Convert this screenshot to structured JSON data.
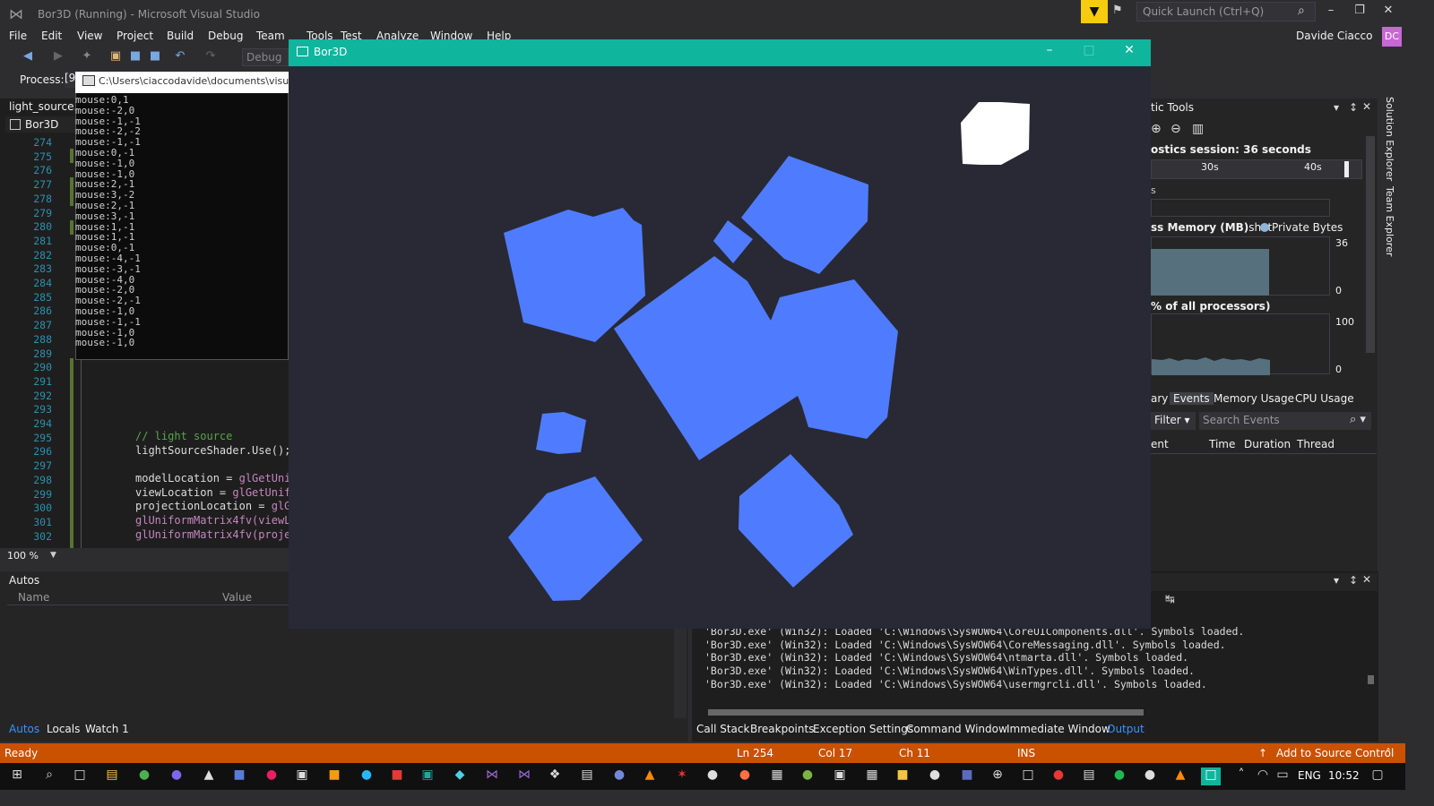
{
  "vs": {
    "title": "Bor3D (Running) - Microsoft Visual Studio",
    "quick_launch_placeholder": "Quick Launch (Ctrl+Q)",
    "user_name": "Davide Ciacco",
    "user_initials": "DC",
    "menus": [
      "File",
      "Edit",
      "View",
      "Project",
      "Build",
      "Debug",
      "Team",
      "Tools",
      "Test",
      "Analyze",
      "Window",
      "Help"
    ],
    "debug_config": "Debug",
    "process_label": "Process:",
    "process_value": "[9"
  },
  "console": {
    "path": "C:\\Users\\ciaccodavide\\documents\\visua",
    "lines": [
      "mouse:0,1",
      "mouse:-2,0",
      "mouse:-1,-1",
      "mouse:-2,-2",
      "mouse:-1,-1",
      "mouse:0,-1",
      "mouse:-1,0",
      "mouse:-1,0",
      "mouse:2,-1",
      "mouse:3,-2",
      "mouse:2,-1",
      "mouse:3,-1",
      "mouse:1,-1",
      "mouse:1,-1",
      "mouse:0,-1",
      "mouse:-4,-1",
      "mouse:-3,-1",
      "mouse:-4,0",
      "mouse:-2,0",
      "mouse:-2,-1",
      "mouse:-1,0",
      "mouse:-1,-1",
      "mouse:-1,0",
      "mouse:-1,0"
    ]
  },
  "editor": {
    "file_tab": "light_source.fr",
    "project_tab": "Bor3D",
    "line_numbers": [
      "274",
      "275",
      "276",
      "277",
      "278",
      "279",
      "280",
      "281",
      "282",
      "283",
      "284",
      "285",
      "286",
      "287",
      "288",
      "289",
      "290",
      "291",
      "292",
      "293",
      "294",
      "295",
      "296",
      "297",
      "298",
      "299",
      "300",
      "301",
      "302"
    ],
    "code": {
      "comment": "// light source",
      "use": "lightSourceShader.Use();",
      "l298_a": "modelLocation = ",
      "l298_b": "glGetUnif",
      "l299_a": "viewLocation = ",
      "l299_b": "glGetUnifo",
      "l300_a": "projectionLocation = ",
      "l300_b": "glGe",
      "l301": "glUniformMatrix4fv(viewLo",
      "l302": "glUniformMatrix4fv(projec"
    },
    "zoom": "100 %"
  },
  "autos": {
    "title": "Autos",
    "col_name": "Name",
    "col_value": "Value",
    "tabs": [
      "Autos",
      "Locals",
      "Watch 1"
    ]
  },
  "diagnostics": {
    "title": "tic Tools",
    "session": "ostics session: 36 seconds",
    "tick_30": "30s",
    "tick_40": "40s",
    "events_label": "s",
    "memory_title": "ss Memory (MB)",
    "memory_legend_snapshot": "shot",
    "memory_legend_private": "Private Bytes",
    "memory_max": "36",
    "memory_min": "0",
    "cpu_title": "% of all processors)",
    "cpu_max": "100",
    "cpu_min": "0",
    "tabs": [
      "ary",
      "Events",
      "Memory Usage",
      "CPU Usage"
    ],
    "filter": "Filter",
    "search_placeholder": "Search Events",
    "columns": [
      "ent",
      "Time",
      "Duration",
      "Thread"
    ],
    "side_tabs": [
      "Solution Explorer",
      "Team Explorer"
    ]
  },
  "output": {
    "lines": [
      "                                                   Symbols loaded.",
      "'Bor3D.exe' (Win32): Loaded 'C:\\Windows\\SysWOW64\\CoreUIComponents.dll'. Symbols loaded.",
      "'Bor3D.exe' (Win32): Loaded 'C:\\Windows\\SysWOW64\\CoreMessaging.dll'. Symbols loaded.",
      "'Bor3D.exe' (Win32): Loaded 'C:\\Windows\\SysWOW64\\ntmarta.dll'. Symbols loaded.",
      "'Bor3D.exe' (Win32): Loaded 'C:\\Windows\\SysWOW64\\WinTypes.dll'. Symbols loaded.",
      "'Bor3D.exe' (Win32): Loaded 'C:\\Windows\\SysWOW64\\usermgrcli.dll'. Symbols loaded."
    ],
    "tabs": [
      "Call Stack",
      "Breakpoints",
      "Exception Settings",
      "Command Window",
      "Immediate Window",
      "Output"
    ]
  },
  "status": {
    "ready": "Ready",
    "ln": "Ln 254",
    "col": "Col 17",
    "ch": "Ch 11",
    "ins": "INS",
    "source_control": "Add to Source Control"
  },
  "taskbar": {
    "lang": "ENG",
    "time": "10:52"
  },
  "app": {
    "title": "Bor3D",
    "accent": "#0fb59c",
    "background": "#282935",
    "shape_color": "#4f7cff",
    "light_color": "#ffffff"
  }
}
